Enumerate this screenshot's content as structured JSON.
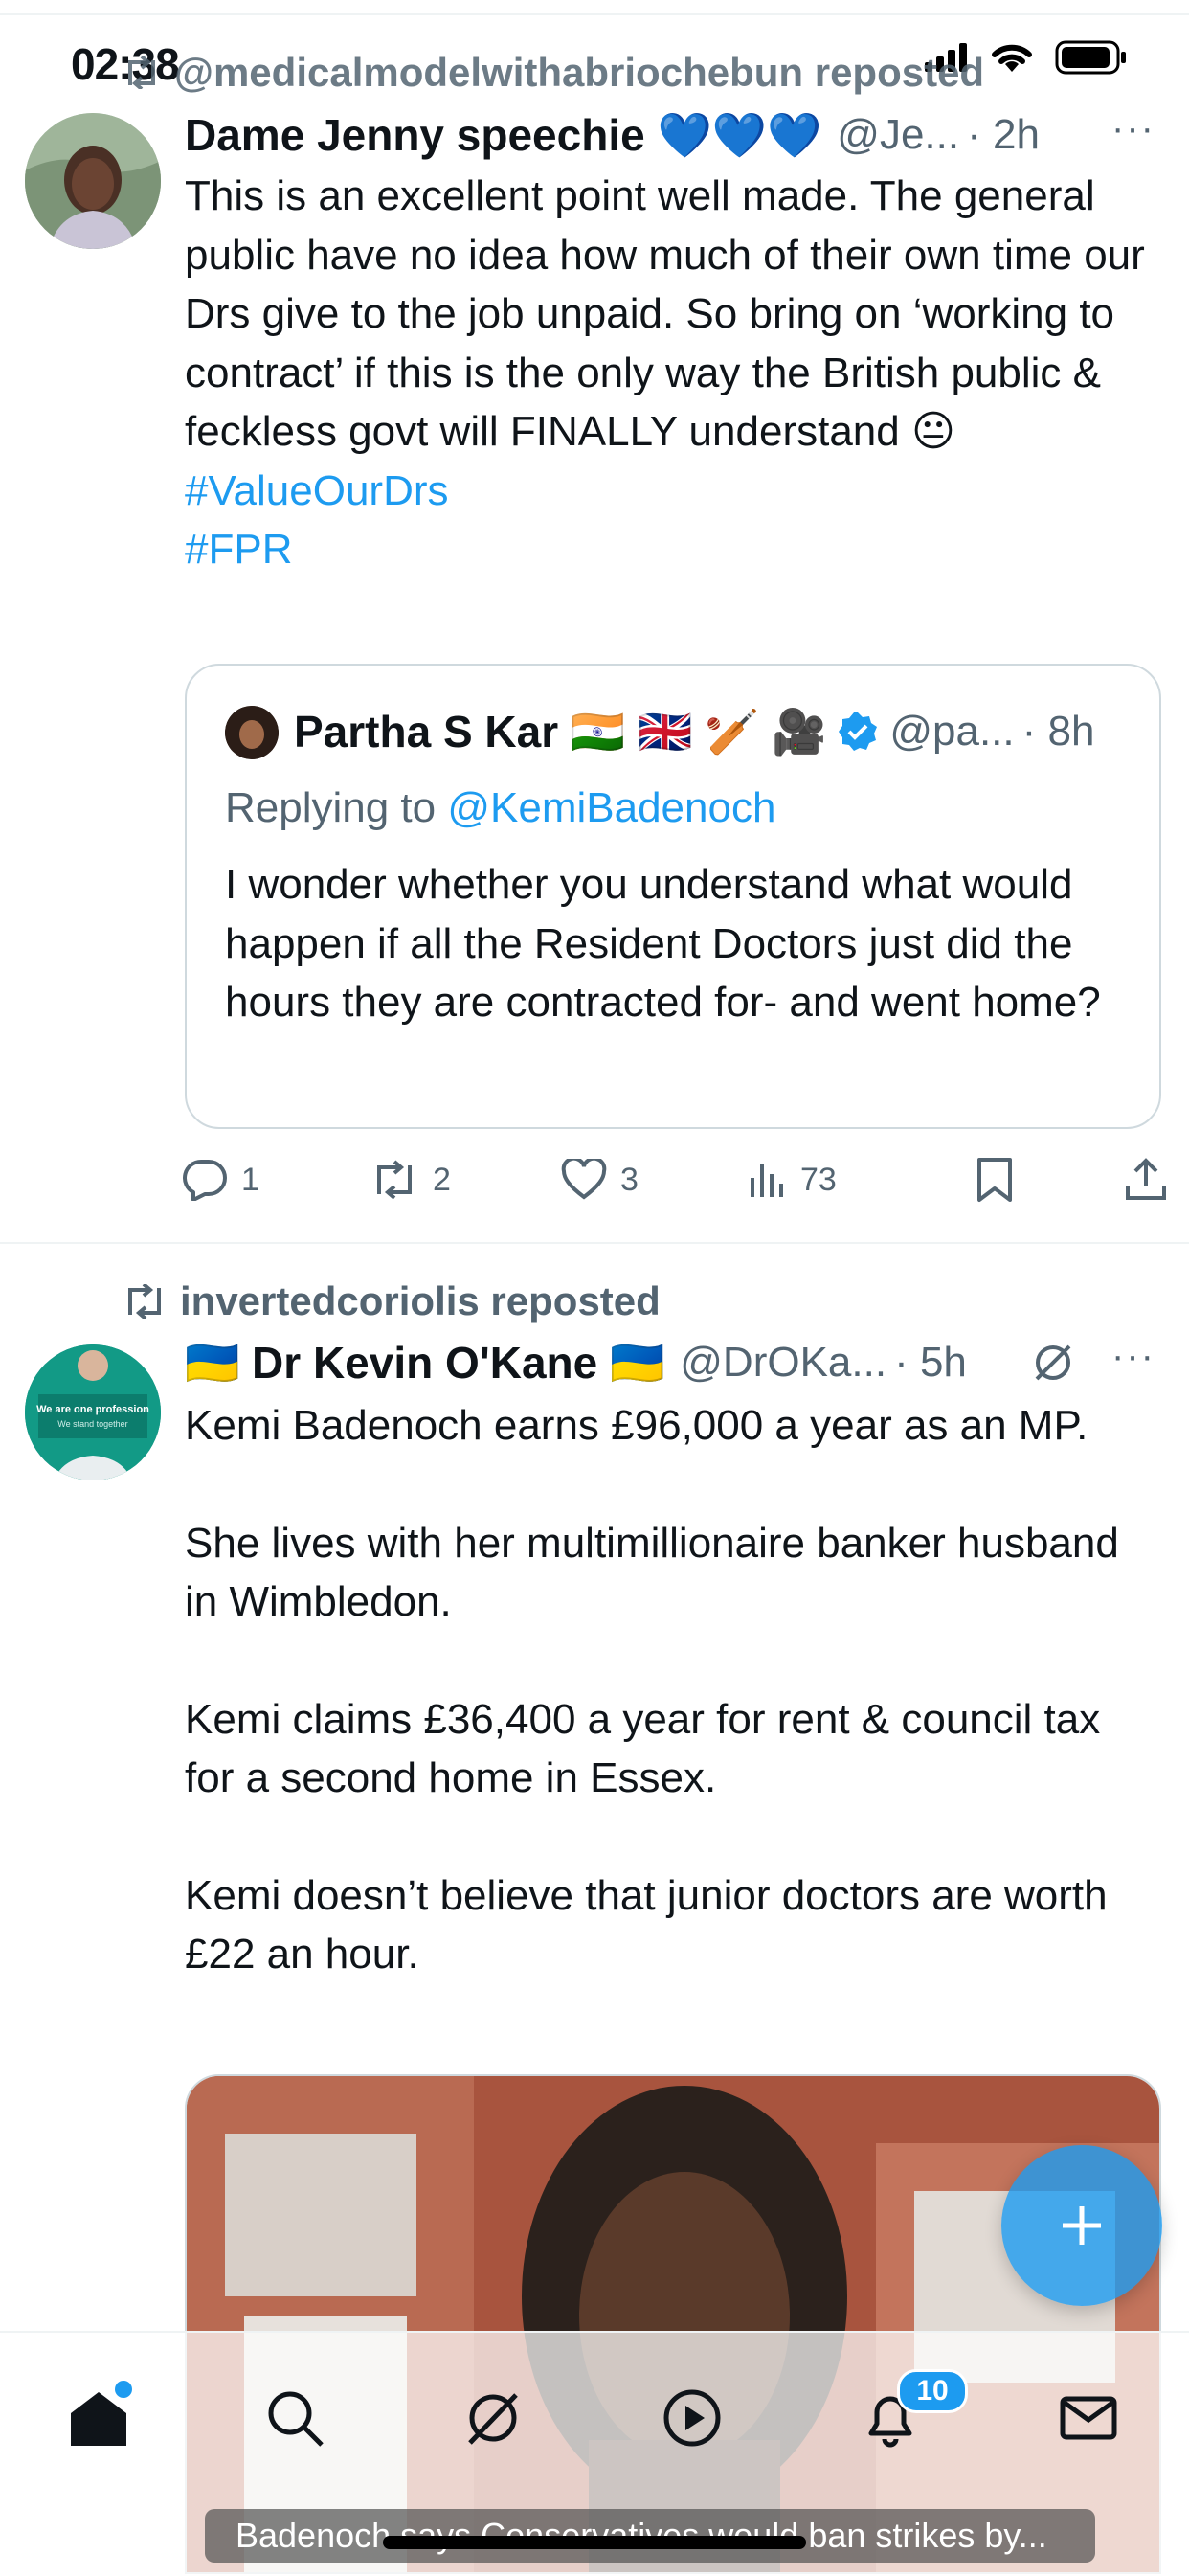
{
  "status": {
    "time": "02:38"
  },
  "tweet1": {
    "repost_label": "@medicalmodelwithabriochebun reposted",
    "display_name": "Dame Jenny speechie 💙💙💙",
    "handle": "@Je...",
    "time": "· 2h",
    "more": "···",
    "text": "This is an excellent point well made. The general public have no idea how much of their own time our Drs give to the job unpaid. So bring on ‘working to contract’ if this is the only way the British public & feckless govt will FINALLY understand 😐",
    "hashtags": [
      "#ValueOurDrs",
      "#FPR"
    ],
    "quote": {
      "display_name": "Partha S Kar 🇮🇳 🇬🇧 🏏 🎥",
      "handle": "@pa...",
      "time": "· 8h",
      "replying_prefix": "Replying to ",
      "replying_to": "@KemiBadenoch",
      "text": "I wonder whether you understand what would happen if all the Resident Doctors just did the hours they are contracted for- and went home?"
    },
    "actions": {
      "replies": "1",
      "reposts": "2",
      "likes": "3",
      "views": "73"
    }
  },
  "tweet2": {
    "repost_label": "invertedcoriolis reposted",
    "display_name": "🇺🇦 Dr Kevin O'Kane 🇺🇦",
    "handle": "@DrOKa...",
    "time": "· 5h",
    "more": "···",
    "paragraphs": [
      "Kemi Badenoch earns £96,000 a year as an MP.",
      "She lives with her multimillionaire banker husband in Wimbledon.",
      "Kemi claims £36,400 a year for rent & council tax for a second home in Essex.",
      "Kemi doesn’t believe that junior doctors are worth £22 an hour."
    ],
    "avatar_text": [
      "We are one profession",
      "We stand together"
    ],
    "media_caption": "Badenoch says Conservatives would ban strikes by..."
  },
  "nav": {
    "notifications_count": "10"
  },
  "colors": {
    "accent": "#1d9bf0",
    "text": "#0f1419",
    "muted": "#536471",
    "border": "#cfd9de"
  }
}
